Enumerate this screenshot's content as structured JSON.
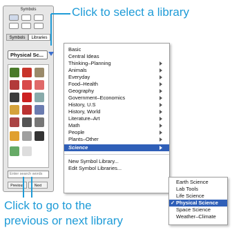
{
  "palette": {
    "title": "Symbols",
    "tabs": [
      "Symbols",
      "Libraries"
    ],
    "library_selected": "Physical Sc...",
    "search_placeholder": "Enter search words",
    "nav_prev": "Previous",
    "nav_next": "Next"
  },
  "callouts": {
    "select": "Click to select a library",
    "prevnext_line1": "Click to go to the",
    "prevnext_line2": "previous or next library"
  },
  "menu": {
    "items": [
      {
        "label": "Basic",
        "arrow": false
      },
      {
        "label": "Central Ideas",
        "arrow": false
      },
      {
        "label": "Thinking–Planning",
        "arrow": true
      },
      {
        "label": "Animals",
        "arrow": true
      },
      {
        "label": "Everyday",
        "arrow": true
      },
      {
        "label": "Food–Health",
        "arrow": true
      },
      {
        "label": "Geography",
        "arrow": true
      },
      {
        "label": "Government–Economics",
        "arrow": true
      },
      {
        "label": "History, U.S",
        "arrow": true
      },
      {
        "label": "History, World",
        "arrow": true
      },
      {
        "label": "Literature–Art",
        "arrow": true
      },
      {
        "label": "Math",
        "arrow": true
      },
      {
        "label": "People",
        "arrow": true
      },
      {
        "label": "Plants–Other",
        "arrow": true
      },
      {
        "label": "Science",
        "arrow": true,
        "highlighted": true
      }
    ],
    "footer": [
      "New Symbol Library...",
      "Edit Symbol Libraries..."
    ]
  },
  "submenu": {
    "items": [
      {
        "label": "Earth Science"
      },
      {
        "label": "Lab Tools"
      },
      {
        "label": "Life Science"
      },
      {
        "label": "Physical Science",
        "checked": true
      },
      {
        "label": "Space Science"
      },
      {
        "label": "Weather–Climate"
      }
    ],
    "checkmark": "✓"
  },
  "colors": {
    "accent": "#1e9bd7",
    "highlight": "#2f5fb8"
  }
}
